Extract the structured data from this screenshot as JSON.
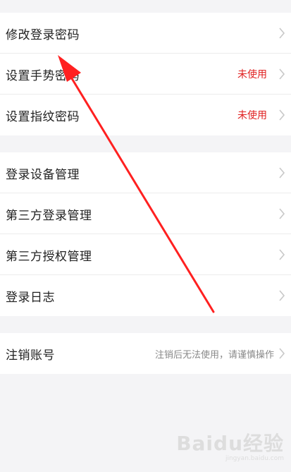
{
  "security_group": {
    "items": [
      {
        "label": "修改登录密码",
        "status": ""
      },
      {
        "label": "设置手势密码",
        "status": "未使用"
      },
      {
        "label": "设置指纹密码",
        "status": "未使用"
      }
    ]
  },
  "device_group": {
    "items": [
      {
        "label": "登录设备管理"
      },
      {
        "label": "第三方登录管理"
      },
      {
        "label": "第三方授权管理"
      },
      {
        "label": "登录日志"
      }
    ]
  },
  "account_group": {
    "items": [
      {
        "label": "注销账号",
        "hint": "注销后无法使用，请谨慎操作"
      }
    ]
  },
  "watermark": {
    "logo": "Baidu经验",
    "url": "jingyan.baidu.com"
  },
  "colors": {
    "background": "#f4f4f6",
    "status_red": "#e02020",
    "annotation_arrow": "#ff2020"
  }
}
